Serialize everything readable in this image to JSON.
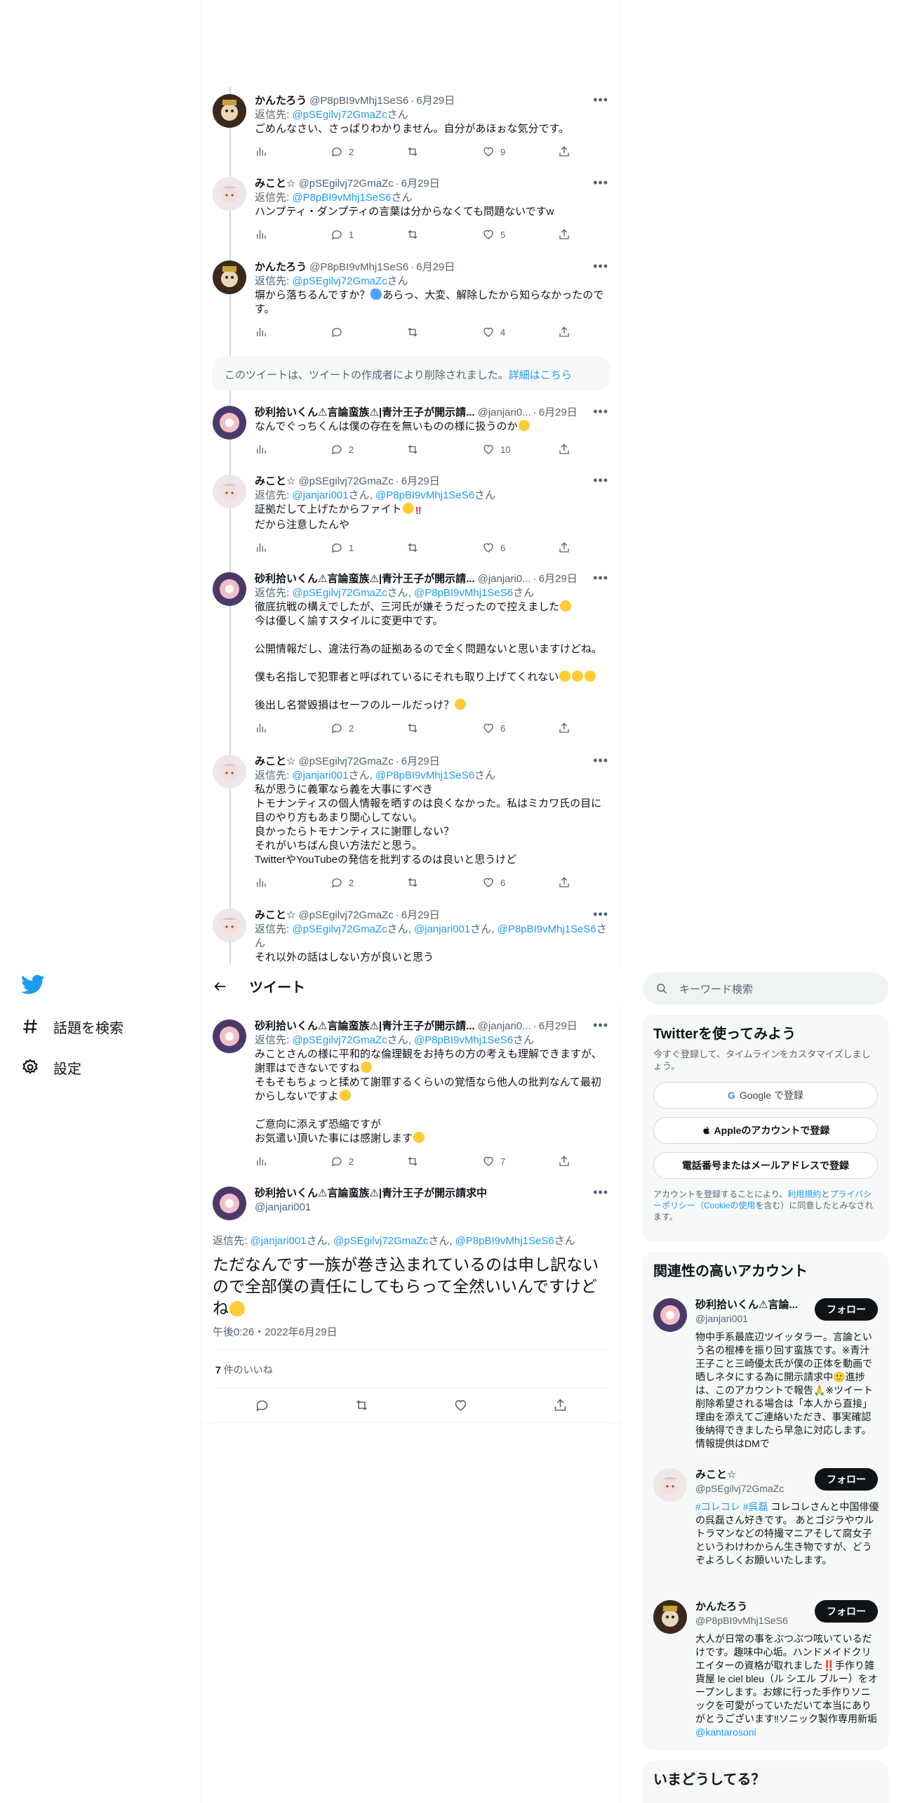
{
  "nav": {
    "logo": "twitter-bird-icon",
    "items": [
      {
        "label": "話題を検索",
        "icon": "hashtag-icon"
      },
      {
        "label": "設定",
        "icon": "gear-icon"
      }
    ]
  },
  "header": {
    "title": "ツイート"
  },
  "tweets": [
    {
      "name": "かんたろう",
      "handle": "@P8pBI9vMhj1SeS6",
      "date": "6月29日",
      "reply_prefix": "返信先: ",
      "reply_to": "@pSEgilvj72GmaZc",
      "reply_suffix": "さん",
      "text": "ごめんなさい、さっぱりわかりません。自分があほぉな気分です。",
      "replies": "2",
      "retweets": "",
      "likes": "9"
    },
    {
      "name": "みこと☆",
      "handle": "@pSEgilvj72GmaZc",
      "date": "6月29日",
      "reply_prefix": "返信先: ",
      "reply_to": "@P8pBI9vMhj1SeS6",
      "reply_suffix": "さん",
      "text": "ハンプティ・ダンプティの言葉は分からなくても問題ないですw",
      "replies": "1",
      "retweets": "",
      "likes": "5"
    },
    {
      "name": "かんたろう",
      "handle": "@P8pBI9vMhj1SeS6",
      "date": "6月29日",
      "reply_prefix": "返信先: ",
      "reply_to": "@pSEgilvj72GmaZc",
      "reply_suffix": "さん",
      "text_a": "塀から落ちるんですか？",
      "text_b": "あらっ、大変、解除したから知らなかったのです。",
      "replies": "",
      "retweets": "",
      "likes": "4"
    },
    {
      "name": "砂利拾いくん⚠言論蛮族⚠|青汁王子が開示請...",
      "handle": "@janjari0...",
      "date": "6月29日",
      "text": "なんでぐっちくんは僕の存在を無いものの様に扱うのか",
      "replies": "2",
      "retweets": "",
      "likes": "10"
    },
    {
      "name": "みこと☆",
      "handle": "@pSEgilvj72GmaZc",
      "date": "6月29日",
      "reply_prefix": "返信先: ",
      "reply_to": "@janjari001",
      "reply_mid": "さん, ",
      "reply_to2": "@P8pBI9vMhj1SeS6",
      "reply_suffix": "さん",
      "text_a": "証拠だして上げたからファイト",
      "text_b": "だから注意したんや",
      "replies": "1",
      "retweets": "",
      "likes": "6"
    },
    {
      "name": "砂利拾いくん⚠言論蛮族⚠|青汁王子が開示請...",
      "handle": "@janjari0...",
      "date": "6月29日",
      "reply_prefix": "返信先: ",
      "reply_to": "@pSEgilvj72GmaZc",
      "reply_mid": "さん, ",
      "reply_to2": "@P8pBI9vMhj1SeS6",
      "reply_suffix": "さん",
      "text_1": "徹底抗戦の構えでしたが、三河氏が嫌そうだったので控えました",
      "text_2": "今は優しく諭すスタイルに変更中です。",
      "text_3": "公開情報だし、違法行為の証拠あるので全く問題ないと思いますけどね。",
      "text_4": "僕も名指しで犯罪者と呼ばれているにそれも取り上げてくれない",
      "text_5": "後出し名誉毀損はセーフのルールだっけ？",
      "replies": "2",
      "retweets": "",
      "likes": "6"
    },
    {
      "name": "みこと☆",
      "handle": "@pSEgilvj72GmaZc",
      "date": "6月29日",
      "reply_prefix": "返信先: ",
      "reply_to": "@janjari001",
      "reply_mid": "さん, ",
      "reply_to2": "@P8pBI9vMhj1SeS6",
      "reply_suffix": "さん",
      "text": "私が思うに義軍なら義を大事にすべき\nトモナンティスの個人情報を晒すのは良くなかった。私はミカワ氏の目に目のやり方もあまり関心してない。\n良かったらトモナンティスに謝罪しない？\nそれがいちばん良い方法だと思う。\nTwitterやYouTubeの発信を批判するのは良いと思うけど",
      "replies": "2",
      "retweets": "",
      "likes": "6"
    },
    {
      "name": "みこと☆",
      "handle": "@pSEgilvj72GmaZc",
      "date": "6月29日",
      "reply_prefix": "返信先: ",
      "reply_to": "@pSEgilvj72GmaZc",
      "reply_mid": "さん, ",
      "reply_to2": "@janjari001",
      "reply_mid2": "さん, ",
      "reply_to3": "@P8pBI9vMhj1SeS6",
      "reply_suffix": "さん",
      "text": "それ以外の話はしない方が良いと思う"
    },
    {
      "name": "砂利拾いくん⚠言論蛮族⚠|青汁王子が開示請...",
      "handle": "@janjari0...",
      "date": "6月29日",
      "reply_prefix": "返信先: ",
      "reply_to": "@pSEgilvj72GmaZc",
      "reply_mid": "さん, ",
      "reply_to2": "@P8pBI9vMhj1SeS6",
      "reply_suffix": "さん",
      "text_1": "みことさんの様に平和的な倫理観をお持ちの方の考えも理解できますが、謝罪はできないですね",
      "text_2": "そもそもちょっと揉めて謝罪するくらいの覚悟なら他人の批判なんて最初からしないですよ",
      "text_3": "ご意向に添えず恐縮ですが",
      "text_4": "お気遣い頂いた事には感謝します",
      "replies": "2",
      "retweets": "",
      "likes": "7"
    }
  ],
  "deleted_notice": {
    "text": "このツイートは、ツイートの作成者により削除されました。",
    "link": "詳細はこちら"
  },
  "main_tweet": {
    "name": "砂利拾いくん⚠言論蛮族⚠|青汁王子が開示請求中",
    "handle": "@janjari001",
    "reply_prefix": "返信先: ",
    "reply_to": "@janjari001",
    "reply_mid": "さん, ",
    "reply_to2": "@pSEgilvj72GmaZc",
    "reply_mid2": "さん, ",
    "reply_to3": "@P8pBI9vMhj1SeS6",
    "reply_suffix": "さん",
    "text": "ただなんです一族が巻き込まれているのは申し訳ないので全部僕の責任にしてもらって全然いいんですけどね",
    "time": "午後0:26・2022年6月29日",
    "likes_count": "7",
    "likes_label": " 件のいいね"
  },
  "right": {
    "search_placeholder": "キーワード検索",
    "signup": {
      "title": "Twitterを使ってみよう",
      "subtitle": "今すぐ登録して、タイムラインをカスタマイズしましょう。",
      "google_label": "Google で登録",
      "apple_label": "Appleのアカウントで登録",
      "phone_label": "電話番号またはメールアドレスで登録",
      "terms_1": "アカウントを登録することにより、",
      "terms_link1": "利用規約",
      "terms_2": "と",
      "terms_link2": "プライバシーポリシー（Cookieの使用",
      "terms_3": "を含む）に同意したとみなされます。"
    },
    "related": {
      "title": "関連性の高いアカウント",
      "follow_label": "フォロー",
      "users": [
        {
          "name": "砂利拾いくん⚠言論...",
          "handle": "@janjari001",
          "bio": "物中手系最底辺ツイッタラー。言論という名の棍棒を振り回す蛮族です。※青汁王子こと三崎優太氏が僕の正体を動画で晒しネタにする為に開示請求中🙂進捗は、このアカウントで報告🙏※ツイート削除希望される場合は「本人から直接」理由を添えてご連絡いただき、事実確認後納得できましたら早急に対応します。情報提供はDMで"
        },
        {
          "name": "みこと☆",
          "handle": "@pSEgilvj72GmaZc",
          "tag1": "#コレコレ",
          "tag2": "#呉磊",
          "bio": " コレコレさんと中国俳優の呉磊さん好きです。 あとゴジラやウルトラマンなどの特撮マニアそして腐女子というわけわからん生き物ですが、どうぞよろしくお願いいたします。"
        },
        {
          "name": "かんたろう",
          "handle": "@P8pBI9vMhj1SeS6",
          "bio": "大人が日常の事をぶつぶつ呟いているだけです。趣味中心垢。ハンドメイドクリエイターの資格が取れました‼️手作り雑貨屋 le ciel bleu（ル シエル ブルー）をオープンします。お嫁に行った手作りソニックを可愛がっていただいて本当にありがとうございます‼ソニック製作専用新垢 ",
          "bio_link": "@kantarosoni"
        }
      ]
    },
    "trend_title": "いまどうしてる？"
  }
}
